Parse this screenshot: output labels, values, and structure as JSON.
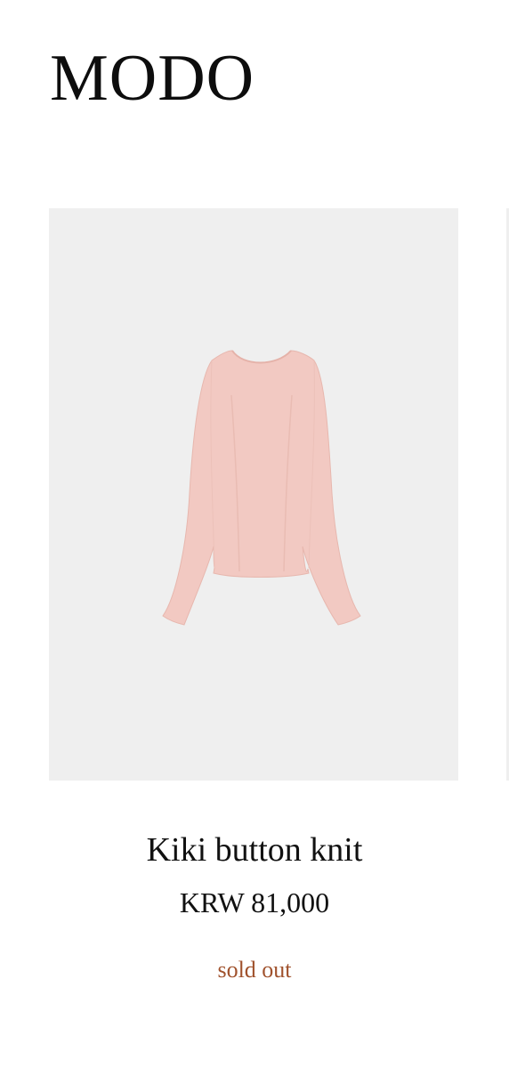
{
  "header": {
    "logo_text": "MODO"
  },
  "product": {
    "name": "Kiki button knit",
    "price": "KRW 81,000",
    "status": "sold out",
    "image_icon": "pink-long-sleeve-knit-top-image"
  },
  "colors": {
    "background": "#ffffff",
    "image_background": "#efefef",
    "garment": "#f2c9c2",
    "status_text": "#a0522d"
  }
}
